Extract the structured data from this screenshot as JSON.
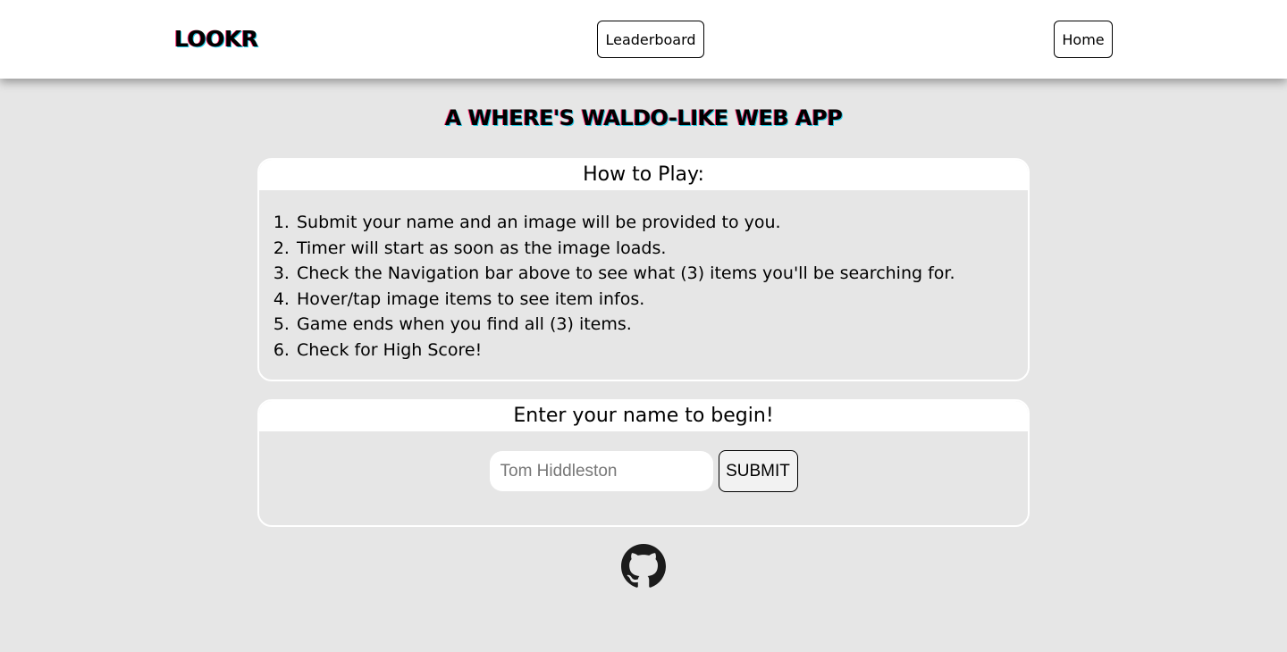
{
  "nav": {
    "logo": "LOOKR",
    "leaderboard_label": "Leaderboard",
    "home_label": "Home"
  },
  "headline": "A WHERE'S WALDO-LIKE WEB APP",
  "how_to_play": {
    "title": "How to Play:",
    "steps": [
      "Submit your name and an image will be provided to you.",
      "Timer will start as soon as the image loads.",
      "Check the Navigation bar above to see what (3) items you'll be searching for.",
      "Hover/tap image items to see item infos.",
      "Game ends when you find all (3) items.",
      "Check for High Score!"
    ]
  },
  "start_form": {
    "title": "Enter your name to begin!",
    "name_value": "",
    "name_placeholder": "Tom Hiddleston",
    "submit_label": "SUBMIT"
  },
  "footer": {
    "icon": "github-icon"
  },
  "colors": {
    "page_bg": "#e6e6e6",
    "navbar_bg": "#ffffff",
    "accent_pink": "#ff2b6b",
    "accent_cyan": "#1ec8e6"
  }
}
